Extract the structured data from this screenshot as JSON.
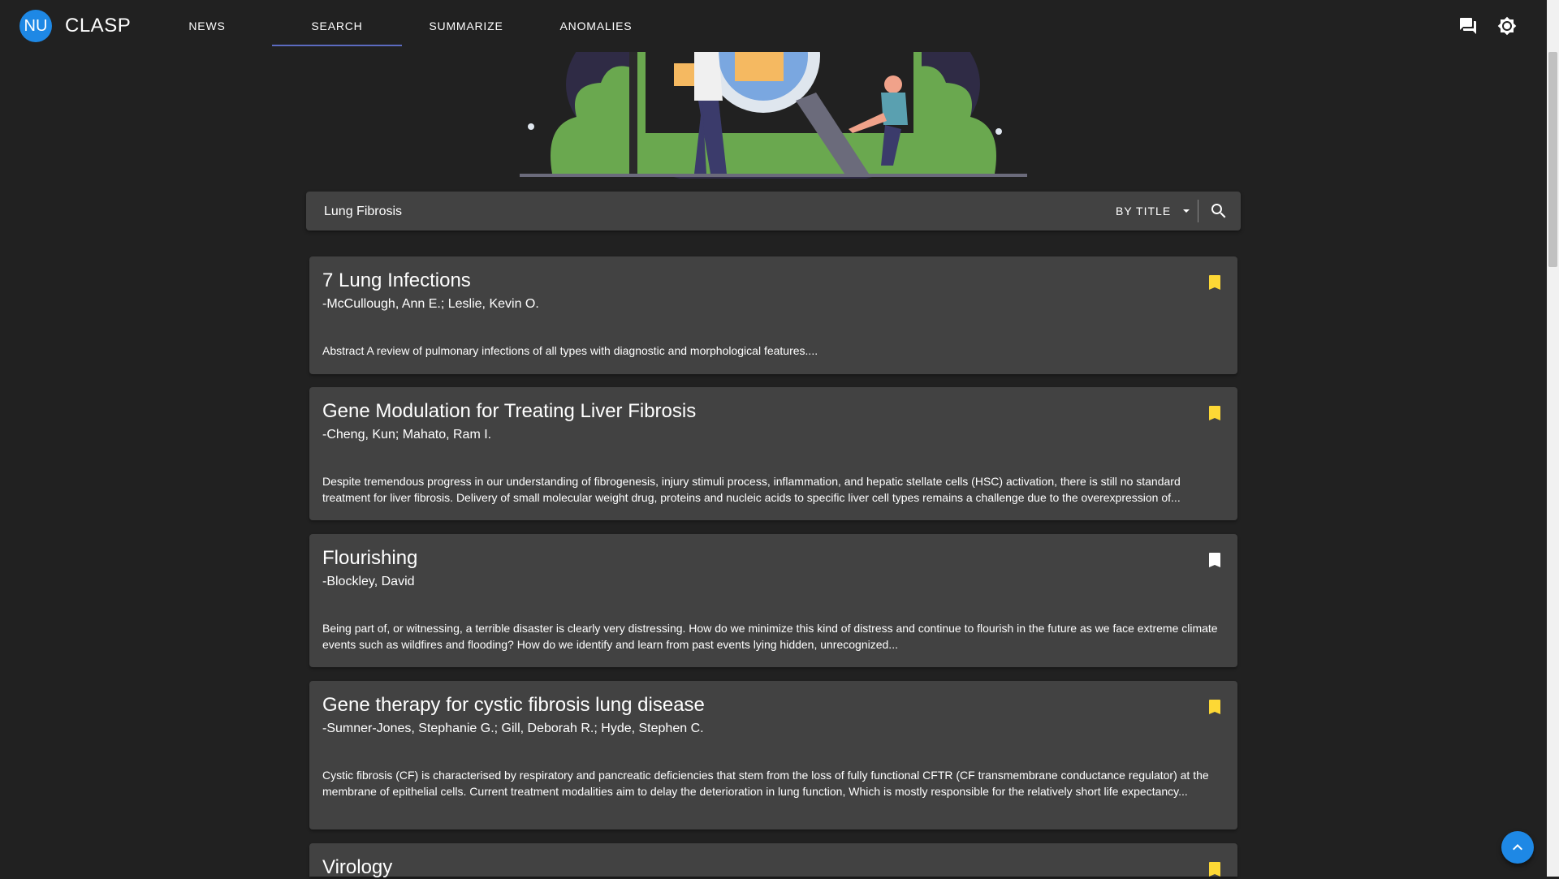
{
  "appbar": {
    "avatar_text": "NU",
    "brand": "CLASP",
    "tabs": [
      {
        "label": "NEWS"
      },
      {
        "label": "SEARCH"
      },
      {
        "label": "SUMMARIZE"
      },
      {
        "label": "ANOMALIES"
      }
    ],
    "active_tab": "SEARCH",
    "icons": [
      "chat-icon",
      "brightness-icon"
    ]
  },
  "search": {
    "value": "Lung Fibrosis",
    "mode": "BY TITLE"
  },
  "results": [
    {
      "title": "7 Lung Infections",
      "authors": "-McCullough, Ann E.; Leslie, Kevin O.",
      "abstract": "Abstract A review of pulmonary infections of all types with diagnostic and morphological features....",
      "bookmark_color": "#fdd835"
    },
    {
      "title": "Gene Modulation for Treating Liver Fibrosis",
      "authors": "-Cheng, Kun; Mahato, Ram I.",
      "abstract": "Despite tremendous progress in our understanding of fibrogenesis, injury stimuli process, inflammation, and hepatic stellate cells (HSC) activation, there is still no standard treatment for liver fibrosis. Delivery of small molecular weight drug, proteins and nucleic acids to specific liver cell types remains a challenge due to the overexpression of...",
      "bookmark_color": "#fdd835"
    },
    {
      "title": "Flourishing",
      "authors": "-Blockley, David",
      "abstract": "Being part of, or witnessing, a terrible disaster is clearly very distressing. How do we minimize this kind of distress and continue to flourish in the future as we face extreme climate events such as wildfires and flooding? How do we identify and learn from past events lying hidden, unrecognized...",
      "bookmark_color": "#ffffff"
    },
    {
      "title": "Gene therapy for cystic fibrosis lung disease",
      "authors": "-Sumner-Jones, Stephanie G.; Gill, Deborah R.; Hyde, Stephen C.",
      "abstract": "Cystic fibrosis (CF) is characterised by respiratory and pancreatic deficiencies that stem from the loss of fully functional CFTR (CF transmembrane conductance regulator) at the membrane of epithelial cells. Current treatment modalities aim to delay the deterioration in lung function, Which is mostly responsible for the relatively short life expectancy...",
      "bookmark_color": "#fdd835"
    },
    {
      "title": "Virology",
      "authors": "",
      "abstract": "",
      "bookmark_color": "#fdd835"
    }
  ],
  "colors": {
    "background": "#212121",
    "card": "#424242",
    "accent": "#1e88e5",
    "tab_indicator": "#5c6bc0",
    "bookmarked": "#fdd835"
  }
}
